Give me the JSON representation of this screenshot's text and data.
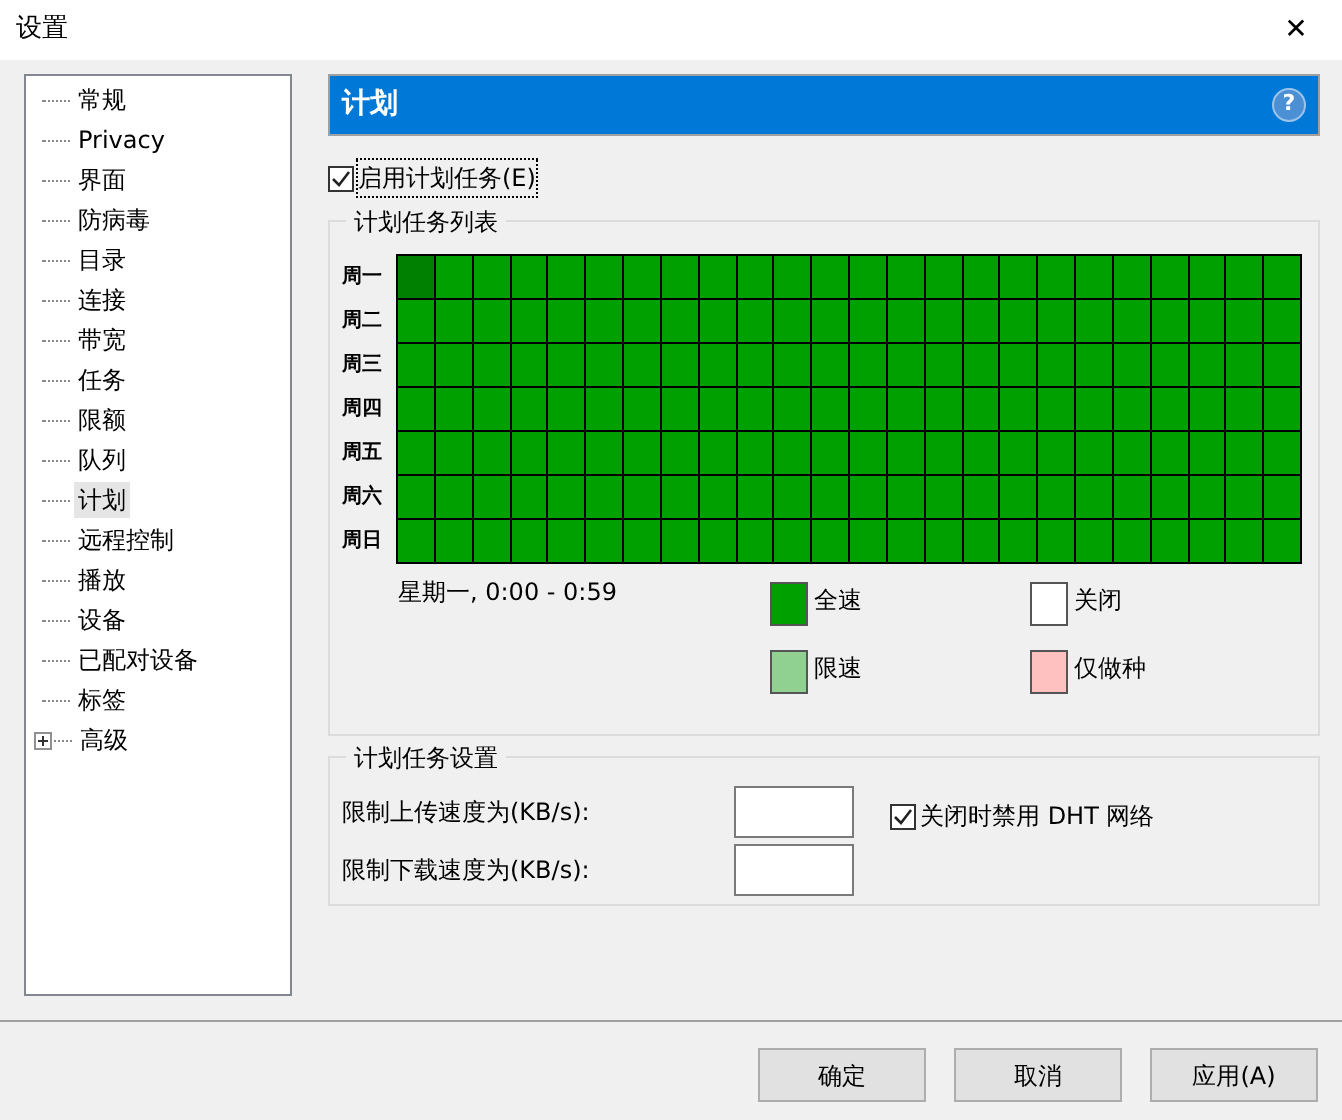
{
  "window": {
    "title": "设置",
    "close": "✕"
  },
  "sidebar": {
    "items": [
      {
        "label": "常规",
        "selected": false
      },
      {
        "label": "Privacy",
        "selected": false
      },
      {
        "label": "界面",
        "selected": false
      },
      {
        "label": "防病毒",
        "selected": false
      },
      {
        "label": "目录",
        "selected": false
      },
      {
        "label": "连接",
        "selected": false
      },
      {
        "label": "带宽",
        "selected": false
      },
      {
        "label": "任务",
        "selected": false
      },
      {
        "label": "限额",
        "selected": false
      },
      {
        "label": "队列",
        "selected": false
      },
      {
        "label": "计划",
        "selected": true
      },
      {
        "label": "远程控制",
        "selected": false
      },
      {
        "label": "播放",
        "selected": false
      },
      {
        "label": "设备",
        "selected": false
      },
      {
        "label": "已配对设备",
        "selected": false
      },
      {
        "label": "标签",
        "selected": false
      },
      {
        "label": "高级",
        "selected": false,
        "expanded": false
      }
    ]
  },
  "header": {
    "title": "计划",
    "help": "?"
  },
  "enable_checkbox": {
    "label": "启用计划任务(E)",
    "checked": true
  },
  "schedule": {
    "title": "计划任务列表",
    "rows": [
      {
        "day": "周一",
        "cells": [
          {
            "kind": "full",
            "selected": true
          },
          {
            "kind": "full",
            "selected": false
          },
          {
            "kind": "full",
            "selected": false
          },
          {
            "kind": "full",
            "selected": false
          },
          {
            "kind": "full",
            "selected": false
          },
          {
            "kind": "full",
            "selected": false
          },
          {
            "kind": "full",
            "selected": false
          },
          {
            "kind": "full",
            "selected": false
          },
          {
            "kind": "full",
            "selected": false
          },
          {
            "kind": "full",
            "selected": false
          },
          {
            "kind": "full",
            "selected": false
          },
          {
            "kind": "full",
            "selected": false
          },
          {
            "kind": "full",
            "selected": false
          },
          {
            "kind": "full",
            "selected": false
          },
          {
            "kind": "full",
            "selected": false
          },
          {
            "kind": "full",
            "selected": false
          },
          {
            "kind": "full",
            "selected": false
          },
          {
            "kind": "full",
            "selected": false
          },
          {
            "kind": "full",
            "selected": false
          },
          {
            "kind": "full",
            "selected": false
          },
          {
            "kind": "full",
            "selected": false
          },
          {
            "kind": "full",
            "selected": false
          },
          {
            "kind": "full",
            "selected": false
          },
          {
            "kind": "full",
            "selected": false
          }
        ]
      },
      {
        "day": "周二",
        "cells": [
          {
            "kind": "full",
            "selected": false
          },
          {
            "kind": "full",
            "selected": false
          },
          {
            "kind": "full",
            "selected": false
          },
          {
            "kind": "full",
            "selected": false
          },
          {
            "kind": "full",
            "selected": false
          },
          {
            "kind": "full",
            "selected": false
          },
          {
            "kind": "full",
            "selected": false
          },
          {
            "kind": "full",
            "selected": false
          },
          {
            "kind": "full",
            "selected": false
          },
          {
            "kind": "full",
            "selected": false
          },
          {
            "kind": "full",
            "selected": false
          },
          {
            "kind": "full",
            "selected": false
          },
          {
            "kind": "full",
            "selected": false
          },
          {
            "kind": "full",
            "selected": false
          },
          {
            "kind": "full",
            "selected": false
          },
          {
            "kind": "full",
            "selected": false
          },
          {
            "kind": "full",
            "selected": false
          },
          {
            "kind": "full",
            "selected": false
          },
          {
            "kind": "full",
            "selected": false
          },
          {
            "kind": "full",
            "selected": false
          },
          {
            "kind": "full",
            "selected": false
          },
          {
            "kind": "full",
            "selected": false
          },
          {
            "kind": "full",
            "selected": false
          },
          {
            "kind": "full",
            "selected": false
          }
        ]
      },
      {
        "day": "周三",
        "cells": [
          {
            "kind": "full",
            "selected": false
          },
          {
            "kind": "full",
            "selected": false
          },
          {
            "kind": "full",
            "selected": false
          },
          {
            "kind": "full",
            "selected": false
          },
          {
            "kind": "full",
            "selected": false
          },
          {
            "kind": "full",
            "selected": false
          },
          {
            "kind": "full",
            "selected": false
          },
          {
            "kind": "full",
            "selected": false
          },
          {
            "kind": "full",
            "selected": false
          },
          {
            "kind": "full",
            "selected": false
          },
          {
            "kind": "full",
            "selected": false
          },
          {
            "kind": "full",
            "selected": false
          },
          {
            "kind": "full",
            "selected": false
          },
          {
            "kind": "full",
            "selected": false
          },
          {
            "kind": "full",
            "selected": false
          },
          {
            "kind": "full",
            "selected": false
          },
          {
            "kind": "full",
            "selected": false
          },
          {
            "kind": "full",
            "selected": false
          },
          {
            "kind": "full",
            "selected": false
          },
          {
            "kind": "full",
            "selected": false
          },
          {
            "kind": "full",
            "selected": false
          },
          {
            "kind": "full",
            "selected": false
          },
          {
            "kind": "full",
            "selected": false
          },
          {
            "kind": "full",
            "selected": false
          }
        ]
      },
      {
        "day": "周四",
        "cells": [
          {
            "kind": "full",
            "selected": false
          },
          {
            "kind": "full",
            "selected": false
          },
          {
            "kind": "full",
            "selected": false
          },
          {
            "kind": "full",
            "selected": false
          },
          {
            "kind": "full",
            "selected": false
          },
          {
            "kind": "full",
            "selected": false
          },
          {
            "kind": "full",
            "selected": false
          },
          {
            "kind": "full",
            "selected": false
          },
          {
            "kind": "full",
            "selected": false
          },
          {
            "kind": "full",
            "selected": false
          },
          {
            "kind": "full",
            "selected": false
          },
          {
            "kind": "full",
            "selected": false
          },
          {
            "kind": "full",
            "selected": false
          },
          {
            "kind": "full",
            "selected": false
          },
          {
            "kind": "full",
            "selected": false
          },
          {
            "kind": "full",
            "selected": false
          },
          {
            "kind": "full",
            "selected": false
          },
          {
            "kind": "full",
            "selected": false
          },
          {
            "kind": "full",
            "selected": false
          },
          {
            "kind": "full",
            "selected": false
          },
          {
            "kind": "full",
            "selected": false
          },
          {
            "kind": "full",
            "selected": false
          },
          {
            "kind": "full",
            "selected": false
          },
          {
            "kind": "full",
            "selected": false
          }
        ]
      },
      {
        "day": "周五",
        "cells": [
          {
            "kind": "full",
            "selected": false
          },
          {
            "kind": "full",
            "selected": false
          },
          {
            "kind": "full",
            "selected": false
          },
          {
            "kind": "full",
            "selected": false
          },
          {
            "kind": "full",
            "selected": false
          },
          {
            "kind": "full",
            "selected": false
          },
          {
            "kind": "full",
            "selected": false
          },
          {
            "kind": "full",
            "selected": false
          },
          {
            "kind": "full",
            "selected": false
          },
          {
            "kind": "full",
            "selected": false
          },
          {
            "kind": "full",
            "selected": false
          },
          {
            "kind": "full",
            "selected": false
          },
          {
            "kind": "full",
            "selected": false
          },
          {
            "kind": "full",
            "selected": false
          },
          {
            "kind": "full",
            "selected": false
          },
          {
            "kind": "full",
            "selected": false
          },
          {
            "kind": "full",
            "selected": false
          },
          {
            "kind": "full",
            "selected": false
          },
          {
            "kind": "full",
            "selected": false
          },
          {
            "kind": "full",
            "selected": false
          },
          {
            "kind": "full",
            "selected": false
          },
          {
            "kind": "full",
            "selected": false
          },
          {
            "kind": "full",
            "selected": false
          },
          {
            "kind": "full",
            "selected": false
          }
        ]
      },
      {
        "day": "周六",
        "cells": [
          {
            "kind": "full",
            "selected": false
          },
          {
            "kind": "full",
            "selected": false
          },
          {
            "kind": "full",
            "selected": false
          },
          {
            "kind": "full",
            "selected": false
          },
          {
            "kind": "full",
            "selected": false
          },
          {
            "kind": "full",
            "selected": false
          },
          {
            "kind": "full",
            "selected": false
          },
          {
            "kind": "full",
            "selected": false
          },
          {
            "kind": "full",
            "selected": false
          },
          {
            "kind": "full",
            "selected": false
          },
          {
            "kind": "full",
            "selected": false
          },
          {
            "kind": "full",
            "selected": false
          },
          {
            "kind": "full",
            "selected": false
          },
          {
            "kind": "full",
            "selected": false
          },
          {
            "kind": "full",
            "selected": false
          },
          {
            "kind": "full",
            "selected": false
          },
          {
            "kind": "full",
            "selected": false
          },
          {
            "kind": "full",
            "selected": false
          },
          {
            "kind": "full",
            "selected": false
          },
          {
            "kind": "full",
            "selected": false
          },
          {
            "kind": "full",
            "selected": false
          },
          {
            "kind": "full",
            "selected": false
          },
          {
            "kind": "full",
            "selected": false
          },
          {
            "kind": "full",
            "selected": false
          }
        ]
      },
      {
        "day": "周日",
        "cells": [
          {
            "kind": "full",
            "selected": false
          },
          {
            "kind": "full",
            "selected": false
          },
          {
            "kind": "full",
            "selected": false
          },
          {
            "kind": "full",
            "selected": false
          },
          {
            "kind": "full",
            "selected": false
          },
          {
            "kind": "full",
            "selected": false
          },
          {
            "kind": "full",
            "selected": false
          },
          {
            "kind": "full",
            "selected": false
          },
          {
            "kind": "full",
            "selected": false
          },
          {
            "kind": "full",
            "selected": false
          },
          {
            "kind": "full",
            "selected": false
          },
          {
            "kind": "full",
            "selected": false
          },
          {
            "kind": "full",
            "selected": false
          },
          {
            "kind": "full",
            "selected": false
          },
          {
            "kind": "full",
            "selected": false
          },
          {
            "kind": "full",
            "selected": false
          },
          {
            "kind": "full",
            "selected": false
          },
          {
            "kind": "full",
            "selected": false
          },
          {
            "kind": "full",
            "selected": false
          },
          {
            "kind": "full",
            "selected": false
          },
          {
            "kind": "full",
            "selected": false
          },
          {
            "kind": "full",
            "selected": false
          },
          {
            "kind": "full",
            "selected": false
          },
          {
            "kind": "full",
            "selected": false
          }
        ]
      }
    ],
    "status": "星期一, 0:00 - 0:59",
    "legend": [
      {
        "kind": "full",
        "label": "全速",
        "color": "#00a000"
      },
      {
        "kind": "off",
        "label": "关闭",
        "color": "#ffffff"
      },
      {
        "kind": "limited",
        "label": "限速",
        "color": "#90d090"
      },
      {
        "kind": "seed",
        "label": "仅做种",
        "color": "#ffc0c0"
      }
    ]
  },
  "settings": {
    "title": "计划任务设置",
    "fields": [
      {
        "label": "限制上传速度为(KB/s):"
      },
      {
        "label": "限制下载速度为(KB/s):"
      }
    ],
    "dht_checkbox": {
      "label": "关闭时禁用 DHT 网络",
      "checked": true
    }
  },
  "buttons": [
    "确定",
    "取消",
    "应用(A)"
  ]
}
